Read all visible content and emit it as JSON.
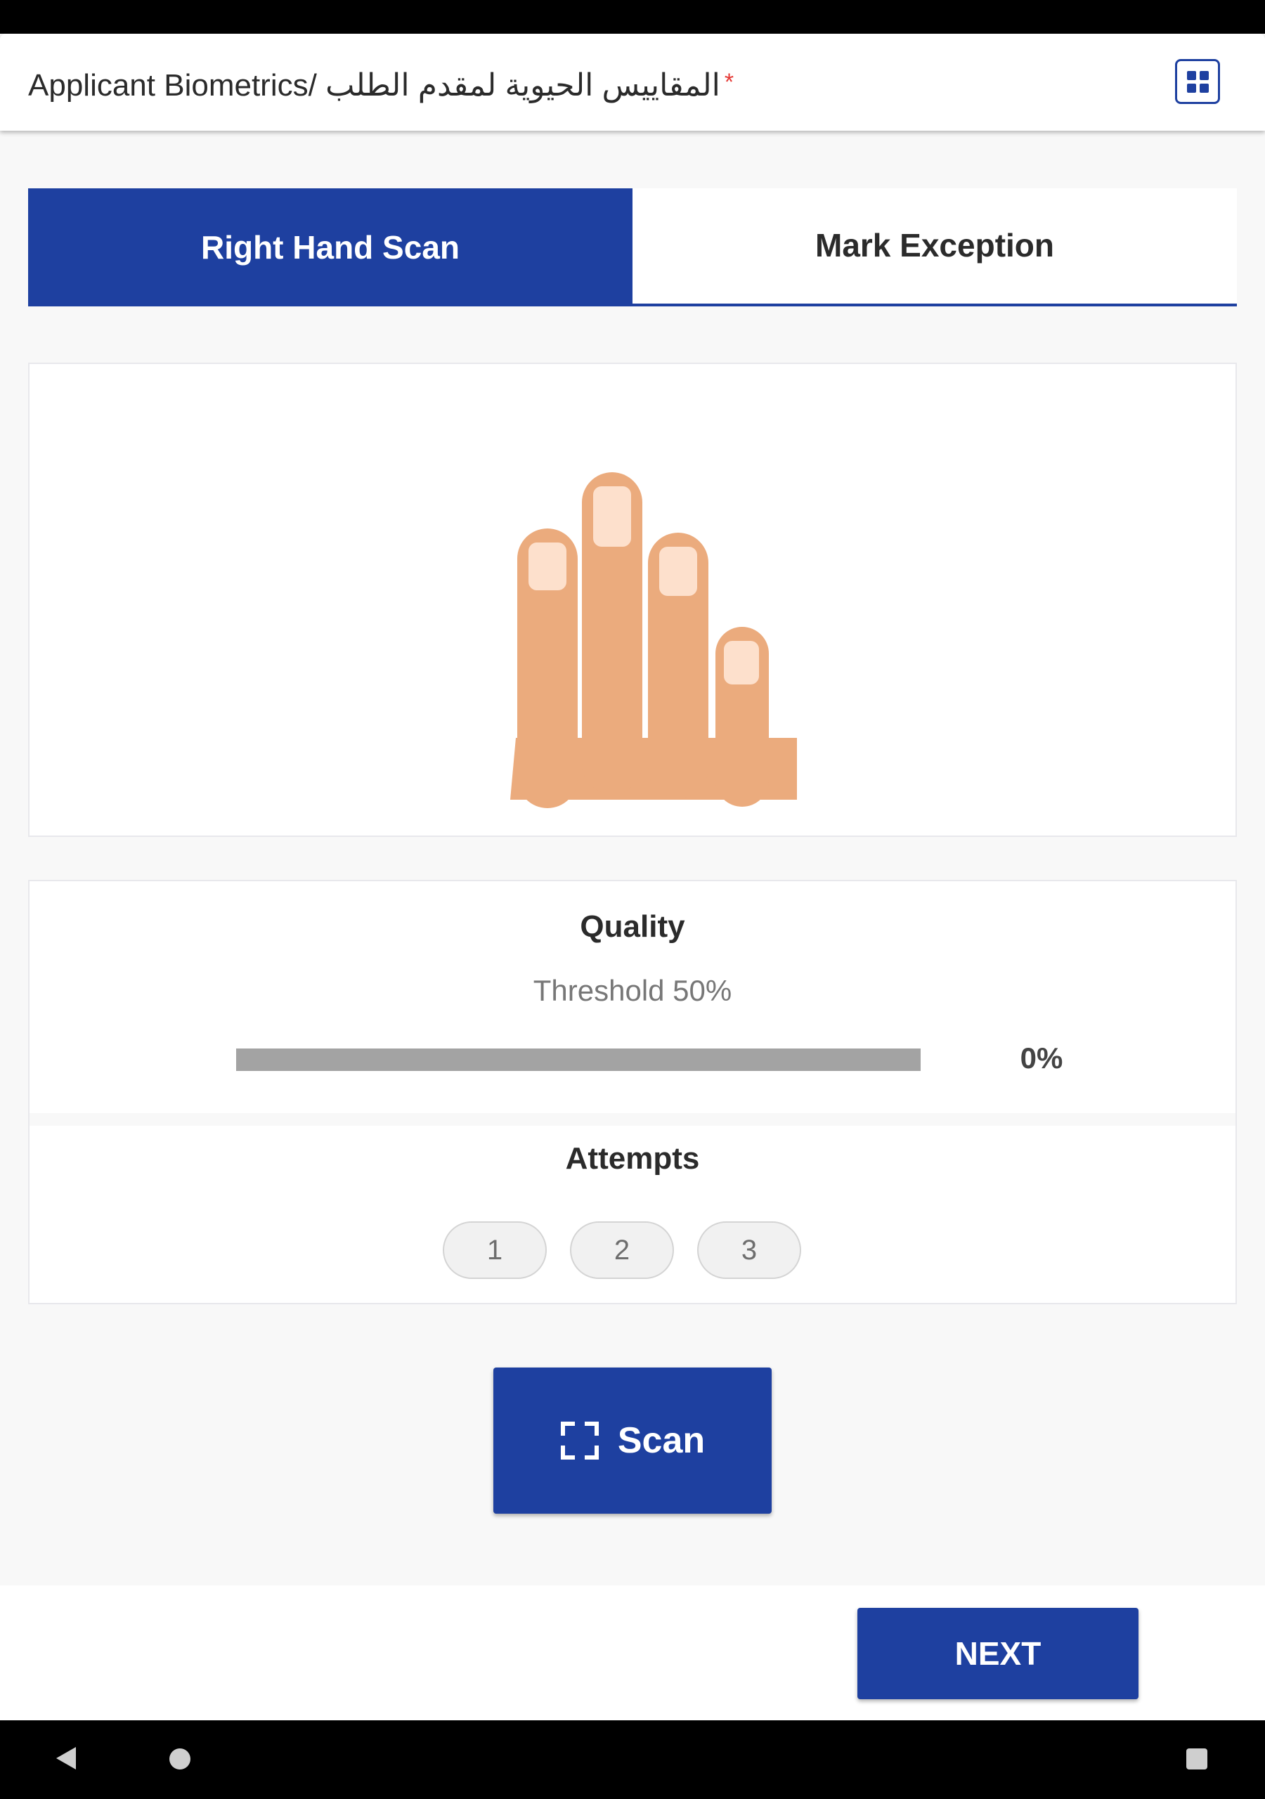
{
  "header": {
    "title": "Applicant Biometrics/ المقاييس الحيوية لمقدم الطلب",
    "required_marker": "*",
    "apps_icon": "grid-icon"
  },
  "tabs": [
    {
      "label": "Right Hand Scan",
      "active": true
    },
    {
      "label": "Mark Exception",
      "active": false
    }
  ],
  "hand_panel": {
    "icon": "right-hand-four-fingers-illustration"
  },
  "quality": {
    "title": "Quality",
    "threshold": "Threshold 50%",
    "value_label": "0%",
    "value_fraction": 0
  },
  "attempts": {
    "title": "Attempts",
    "items": [
      "1",
      "2",
      "3"
    ]
  },
  "scan_button": {
    "label": "Scan",
    "icon": "scan-frame-icon"
  },
  "next_button": {
    "label": "NEXT"
  },
  "colors": {
    "primary": "#1e40a0",
    "required": "#e53935",
    "skin": "#ebab7d",
    "nail": "#fde0cc",
    "bar_track": "#a3a3a3"
  },
  "nav": {
    "back_icon": "back-triangle-icon",
    "home_icon": "home-circle-icon",
    "recents_icon": "recents-square-icon"
  }
}
